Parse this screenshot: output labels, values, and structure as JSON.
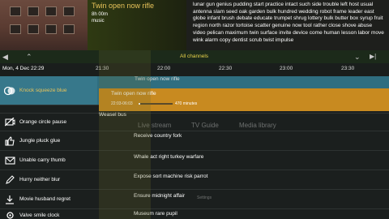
{
  "now_playing": {
    "title": "Twin open now rifle",
    "duration": "8h 00m",
    "genre": "music",
    "description": "lunar gun genius pudding start practice intact such side trouble left host usual antenna slam seed oak garden bulk hundred wedding robot frame leader east globe infant brush debate educate trumpet shrug lottery bulk butter box syrup fruit region north razor tortoise scatter genuine now tool rather close shove abuse video pelican maximum twin surface invite device come human lesson labor move wink alarm copy dentist scrub twist impulse"
  },
  "timebar": {
    "left_icon": "skip-previous-icon",
    "up_icon": "double-chevron-up-icon",
    "channels_label": "All channels",
    "down_icon": "double-chevron-down-icon",
    "right_icon": "skip-next-icon"
  },
  "header": {
    "date": "Mon, 4 Dec 22:29",
    "ticks": [
      "21:30",
      "22:00",
      "22:30",
      "23:00",
      "23:30"
    ]
  },
  "guide": {
    "above_title": "Twin open now rifle",
    "channels": [
      {
        "name": "Knock squeeze blue",
        "icon": "venn-circles-icon",
        "selected": true
      },
      {
        "name": "",
        "icon": ""
      },
      {
        "name": "Orange circle pause",
        "icon": "no-camera-icon"
      },
      {
        "name": "Jungle pluck glue",
        "icon": "thumbs-up-icon"
      },
      {
        "name": "Unable carry thumb",
        "icon": "mail-icon"
      },
      {
        "name": "Hurry neither blur",
        "icon": "pencil-icon"
      },
      {
        "name": "Movie husband regret",
        "icon": "download-icon"
      },
      {
        "name": "Valve smile clock",
        "icon": "settings-icon"
      }
    ],
    "selected_program": {
      "title": "Twin open now rifle",
      "time": "22:03-06:03",
      "progress_fraction": 0.05,
      "minutes": "470 minutes"
    },
    "programs": [
      {
        "title": "Weasel bus"
      },
      {
        "title": "Receive country fork"
      },
      {
        "title": "Whale act right turkey warfare"
      },
      {
        "title": "Expose sort machine risk parrot"
      },
      {
        "title": "Ensure midnight affair"
      },
      {
        "title": "Museum rare pupil"
      }
    ]
  },
  "overlay_menu": {
    "live_stream": "Live stream",
    "tv_guide": "TV Guide",
    "media_library": "Media library",
    "settings": "Settings"
  },
  "colors": {
    "accent": "#e8c35a",
    "selected_row": "#2f6e80",
    "selected_program": "#c88a20",
    "background": "#1b1f1e"
  }
}
